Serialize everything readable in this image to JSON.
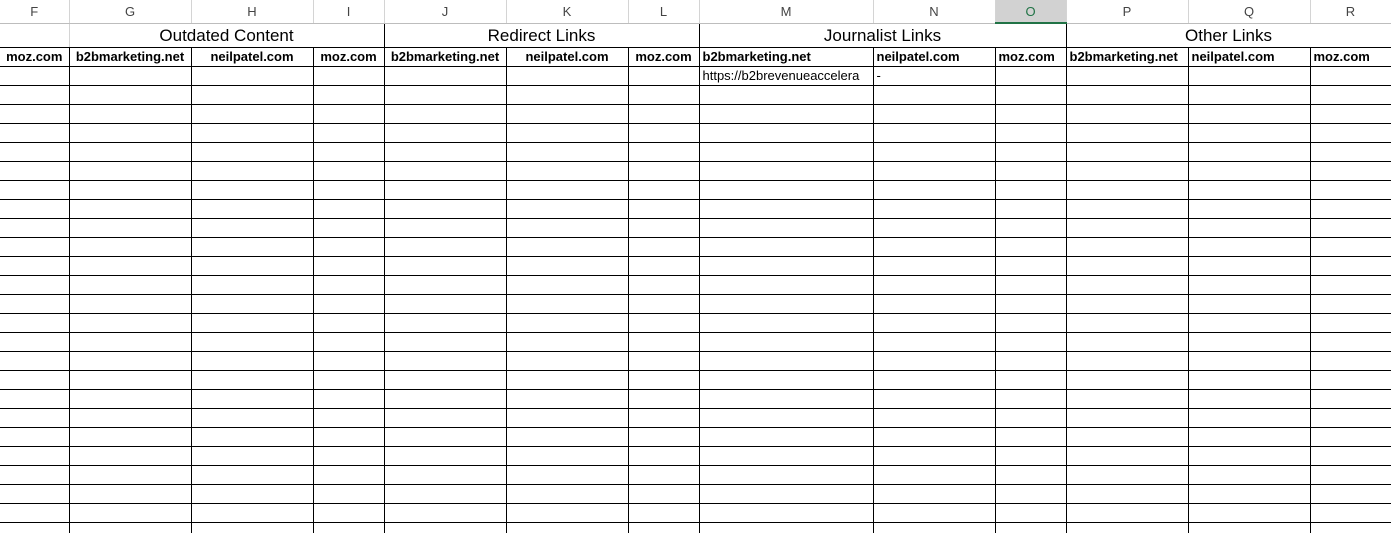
{
  "columns": [
    "F",
    "G",
    "H",
    "I",
    "J",
    "K",
    "L",
    "M",
    "N",
    "O",
    "P",
    "Q",
    "R"
  ],
  "selected_column": "O",
  "groups": {
    "outdated": "Outdated Content",
    "redirect": "Redirect Links",
    "journalist": "Journalist Links",
    "other": "Other Links"
  },
  "sites": {
    "f": "moz.com",
    "g": "b2bmarketing.net",
    "h": "neilpatel.com",
    "i": "moz.com",
    "j": "b2bmarketing.net",
    "k": "neilpatel.com",
    "l": "moz.com",
    "m": "b2bmarketing.net",
    "n": "neilpatel.com",
    "o": "moz.com",
    "p": "b2bmarketing.net",
    "q": "neilpatel.com",
    "r": "moz.com"
  },
  "first_data_row": {
    "m": "https://b2brevenueaccelera",
    "n": "-"
  },
  "colors": {
    "selected_header_accent": "#217346",
    "grid_line": "#000000",
    "header_bg": "#ffffff"
  }
}
